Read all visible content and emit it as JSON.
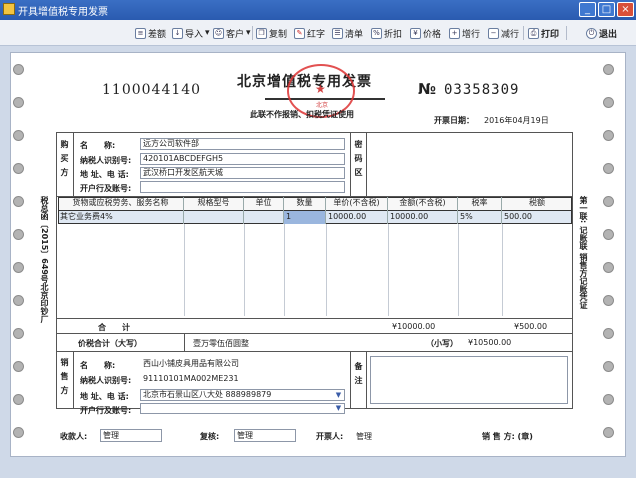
{
  "window": {
    "title": "开具增值税专用发票",
    "min": "_",
    "max": "□",
    "close": "×"
  },
  "toolbar": [
    {
      "label": "差额",
      "icon": "difference-icon"
    },
    {
      "label": "导入",
      "icon": "import-icon"
    },
    {
      "label": "客户",
      "icon": "customer-icon"
    },
    {
      "label": "复制",
      "icon": "copy-icon"
    },
    {
      "label": "红字",
      "icon": "red-invoice-icon"
    },
    {
      "label": "清单",
      "icon": "list-icon"
    },
    {
      "label": "折扣",
      "icon": "discount-icon"
    },
    {
      "label": "价格",
      "icon": "price-icon"
    },
    {
      "label": "增行",
      "icon": "add-row-icon"
    },
    {
      "label": "减行",
      "icon": "delete-row-icon"
    },
    {
      "label": "打印",
      "icon": "print-icon"
    },
    {
      "label": "退出",
      "icon": "exit-icon"
    }
  ],
  "invoice": {
    "code": "1100044140",
    "title": "北京增值税专用发票",
    "no_symbol": "№",
    "number": "03358309",
    "subtitle": "此联不作报销、扣税凭证使用",
    "seal_text": "北京",
    "seal_star": "★",
    "date_label": "开票日期：",
    "date": "2016年04月19日"
  },
  "buyer": {
    "side_label": "购买方",
    "name_label": "名　　称:",
    "name": "远方公司软件部",
    "tax_id_label": "纳税人识别号:",
    "tax_id": "420101ABCDEFGH5",
    "address_label": "地 址、电 话:",
    "address": "武汉桥口开发区航天城",
    "bank_label": "开户行及账号:",
    "bank": "",
    "cipher_label": "密码区"
  },
  "goods_table": {
    "headers": [
      "货物或应税劳务、服务名称",
      "规格型号",
      "单位",
      "数量",
      "单价(不含税)",
      "金额(不含税)",
      "税率",
      "税额"
    ],
    "rows": [
      [
        "其它业务费4%",
        "",
        "",
        "1",
        "10000.00",
        "10000.00",
        "5%",
        "500.00"
      ]
    ]
  },
  "totals": {
    "label": "合　　计",
    "amount": "¥10000.00",
    "tax": "¥500.00",
    "grand_label": "价税合计（大写）",
    "grand_words": "壹万零伍佰圆整",
    "small_label": "（小写）",
    "grand_number": "¥10500.00"
  },
  "seller": {
    "side_label": "销售方",
    "name_label": "名　　称:",
    "name": "西山小铺皮具用品有限公司",
    "tax_id_label": "纳税人识别号:",
    "tax_id": "91110101MA002ME231",
    "address_label": "地 址、电 话:",
    "address": "北京市石景山区八大处 888989879",
    "bank_label": "开户行及账号:",
    "bank": "",
    "remarks_label": "备注"
  },
  "signatures": {
    "payee_label": "收款人:",
    "payee": "管理",
    "reviewer_label": "复核:",
    "reviewer": "管理",
    "issuer_label": "开票人:",
    "issuer": "管理",
    "seller_label": "销 售 方: (章)"
  },
  "side_texts": {
    "left": "税总函〔2015〕649号北京印钞厂",
    "right": "第一联: 记账联 销售方记账凭证"
  }
}
